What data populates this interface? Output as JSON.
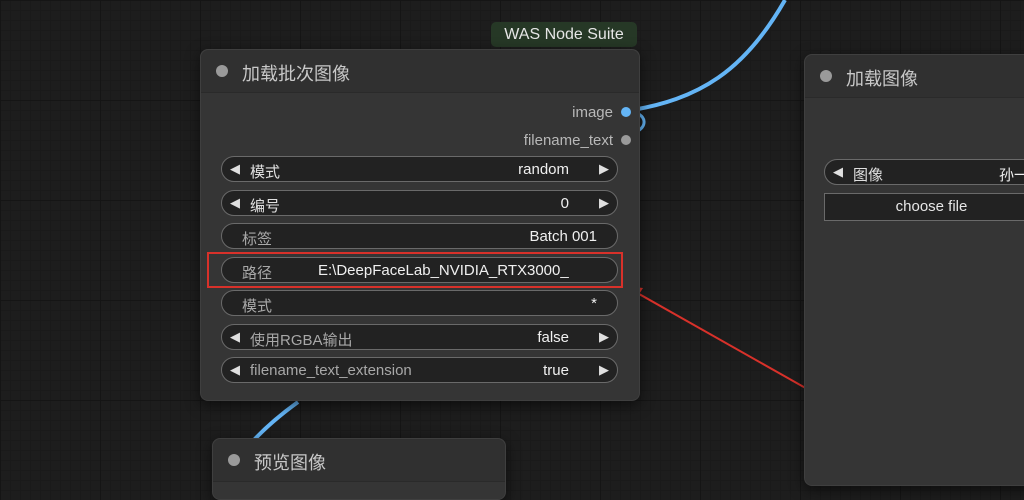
{
  "badge": "WAS Node Suite",
  "node_main": {
    "title": "加载批次图像",
    "outputs": [
      {
        "label": "image",
        "color": "#64b5f6"
      },
      {
        "label": "filename_text",
        "color": "#9a9a9a"
      }
    ],
    "widgets": [
      {
        "label": "模式",
        "value": "random",
        "arrows": true
      },
      {
        "label": "编号",
        "value": "0",
        "arrows": true
      },
      {
        "label": "标签",
        "value": "Batch 001",
        "arrows": false
      },
      {
        "label": "路径",
        "value": "E:\\DeepFaceLab_NVIDIA_RTX3000_",
        "arrows": false
      },
      {
        "label": "模式",
        "value": "*",
        "arrows": false
      },
      {
        "label": "使用RGBA输出",
        "value": "false",
        "arrows": true
      },
      {
        "label": "filename_text_extension",
        "value": "true",
        "arrows": true
      }
    ]
  },
  "node_right": {
    "title": "加载图像",
    "image_widget_label": "图像",
    "image_widget_value": "孙一",
    "choose_button": "choose file"
  },
  "node_bottom": {
    "title": "预览图像"
  },
  "icons": {
    "left_arrow": "◀",
    "right_arrow": "▶"
  },
  "colors": {
    "link": "#64b5f6",
    "highlight": "#d8312a",
    "badge_bg": "#263826"
  }
}
